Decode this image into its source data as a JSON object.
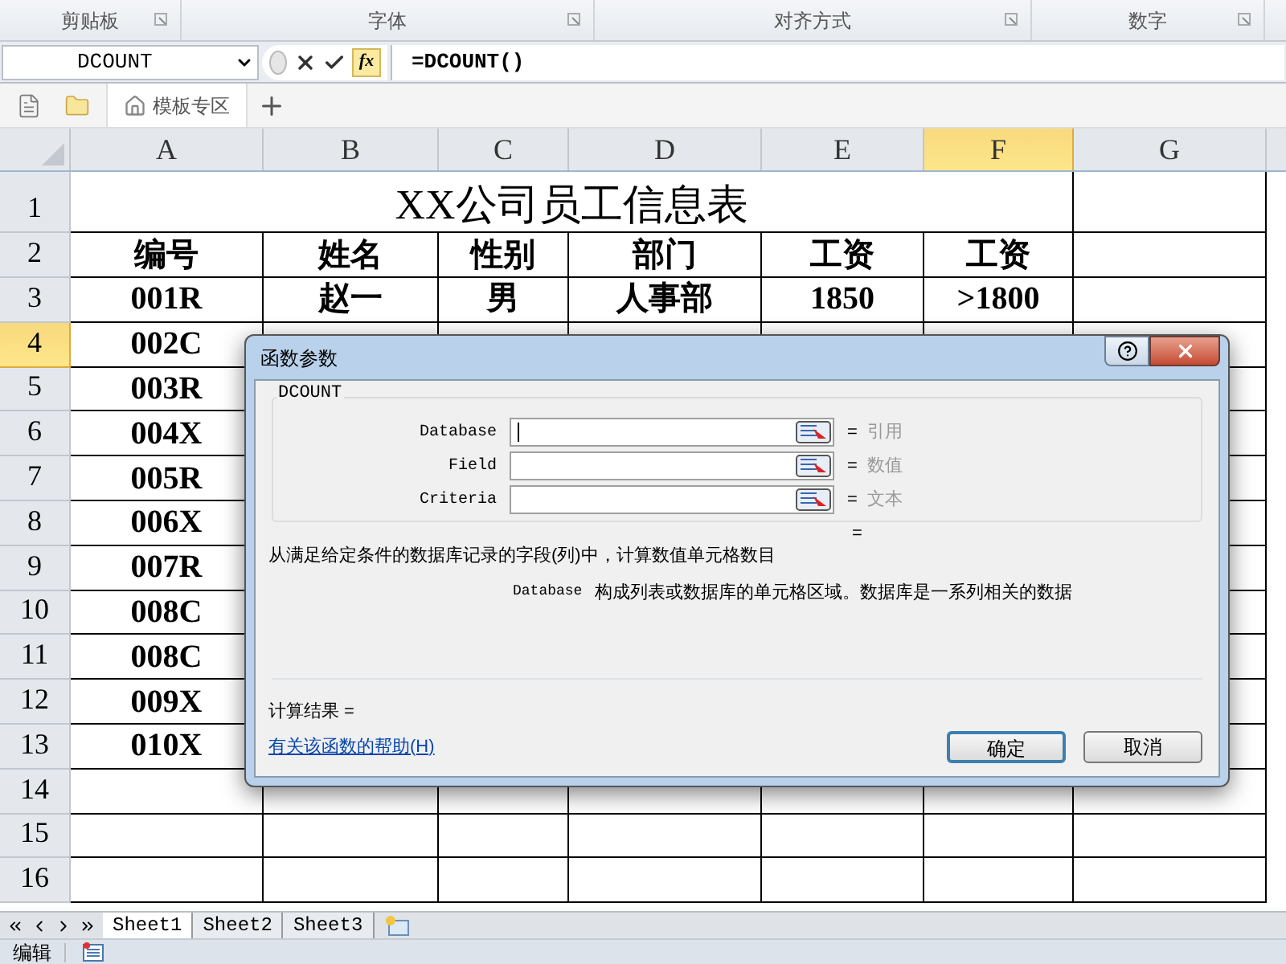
{
  "ribbon_groups": [
    {
      "label": "剪贴板"
    },
    {
      "label": "字体"
    },
    {
      "label": "对齐方式"
    },
    {
      "label": "数字"
    }
  ],
  "formula_bar": {
    "name_box": "DCOUNT",
    "function_button": "fx",
    "formula": "=DCOUNT()"
  },
  "quick_tabs": [
    {
      "label": "模板专区"
    }
  ],
  "columns": [
    {
      "label": "A",
      "selected": false
    },
    {
      "label": "B",
      "selected": false
    },
    {
      "label": "C",
      "selected": false
    },
    {
      "label": "D",
      "selected": false
    },
    {
      "label": "E",
      "selected": false
    },
    {
      "label": "F",
      "selected": true
    },
    {
      "label": "G",
      "selected": false
    }
  ],
  "sheet_title": "XX公司员工信息表",
  "rows": [
    {
      "header": "1",
      "selected": false,
      "cells": []
    },
    {
      "header": "2",
      "selected": false,
      "cells": [
        "编号",
        "姓名",
        "性别",
        "部门",
        "工资",
        "工资"
      ]
    },
    {
      "header": "3",
      "selected": false,
      "cells": [
        "001R",
        "赵一",
        "男",
        "人事部",
        "1850",
        ">1800"
      ]
    },
    {
      "header": "4",
      "selected": true,
      "cells": [
        "002C"
      ]
    },
    {
      "header": "5",
      "selected": false,
      "cells": [
        "003R"
      ]
    },
    {
      "header": "6",
      "selected": false,
      "cells": [
        "004X"
      ]
    },
    {
      "header": "7",
      "selected": false,
      "cells": [
        "005R"
      ]
    },
    {
      "header": "8",
      "selected": false,
      "cells": [
        "006X"
      ]
    },
    {
      "header": "9",
      "selected": false,
      "cells": [
        "007R"
      ]
    },
    {
      "header": "10",
      "selected": false,
      "cells": [
        "008C"
      ]
    },
    {
      "header": "11",
      "selected": false,
      "cells": [
        "008C"
      ]
    },
    {
      "header": "12",
      "selected": false,
      "cells": [
        "009X"
      ]
    },
    {
      "header": "13",
      "selected": false,
      "cells": [
        "010X"
      ]
    },
    {
      "header": "14",
      "selected": false,
      "cells": []
    },
    {
      "header": "15",
      "selected": false,
      "cells": []
    },
    {
      "header": "16",
      "selected": false,
      "cells": []
    }
  ],
  "dialog": {
    "title": "函数参数",
    "function_name": "DCOUNT",
    "arguments": [
      {
        "name": "Database",
        "sign": "=",
        "hint": "引用",
        "focused": true
      },
      {
        "name": "Field",
        "sign": "=",
        "hint": "数值",
        "focused": false
      },
      {
        "name": "Criteria",
        "sign": "=",
        "hint": "文本",
        "focused": false
      }
    ],
    "result_sign": "=",
    "description": "从满足给定条件的数据库记录的字段(列)中，计算数值单元格数目",
    "argument_help": {
      "name": "Database",
      "text": "构成列表或数据库的单元格区域。数据库是一系列相关的数据"
    },
    "result_label": "计算结果 =",
    "help_link": "有关该函数的帮助(H)",
    "buttons": [
      {
        "label": "确定",
        "kind": "default"
      },
      {
        "label": "取消",
        "kind": "normal"
      }
    ]
  },
  "sheet_tabs": [
    {
      "label": "Sheet1",
      "selected": true
    },
    {
      "label": "Sheet2",
      "selected": false
    },
    {
      "label": "Sheet3",
      "selected": false
    }
  ],
  "status_bar": {
    "mode": "编辑"
  }
}
